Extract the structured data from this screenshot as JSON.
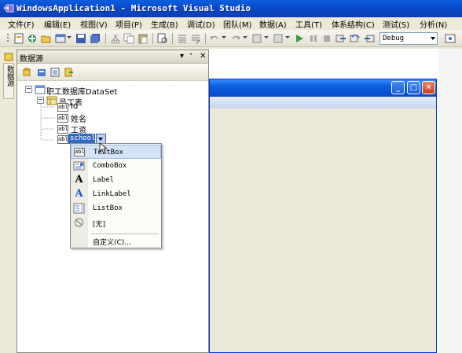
{
  "window": {
    "title": "WindowsApplication1 - Microsoft Visual Studio"
  },
  "menu": [
    {
      "label": "文件(F)"
    },
    {
      "label": "编辑(E)"
    },
    {
      "label": "视图(V)"
    },
    {
      "label": "项目(P)"
    },
    {
      "label": "生成(B)"
    },
    {
      "label": "调试(D)"
    },
    {
      "label": "团队(M)"
    },
    {
      "label": "数据(A)"
    },
    {
      "label": "工具(T)"
    },
    {
      "label": "体系结构(C)"
    },
    {
      "label": "测试(S)"
    },
    {
      "label": "分析(N)"
    }
  ],
  "toolbar": {
    "configuration": "Debug"
  },
  "left_strip": {
    "tab_label": "数据源"
  },
  "data_sources": {
    "title": "数据源",
    "header_buttons": {
      "dropdown": "▾",
      "pin": "ᐩ",
      "close": "✕"
    },
    "tree": {
      "dataset": "职工数据库DataSet",
      "table": "员工表",
      "fields": [
        {
          "label": "Id",
          "icon_text": "abl"
        },
        {
          "label": "姓名",
          "icon_text": "abl"
        },
        {
          "label": "工资",
          "icon_text": "abl"
        }
      ],
      "selected_field": {
        "label": "school",
        "icon_text": "abl"
      },
      "expander_minus": "−"
    }
  },
  "control_menu": {
    "items": [
      {
        "label": "TextBox",
        "icon": "textbox-icon",
        "icon_text": "abl",
        "selected": true
      },
      {
        "label": "ComboBox",
        "icon": "combobox-icon"
      },
      {
        "label": "Label",
        "icon": "label-icon",
        "icon_text": "A"
      },
      {
        "label": "LinkLabel",
        "icon": "linklabel-icon",
        "icon_text": "A"
      },
      {
        "label": "ListBox",
        "icon": "listbox-icon"
      },
      {
        "label": "[无]",
        "icon": "none-icon"
      }
    ],
    "customize": "自定义(C)..."
  },
  "form": {
    "buttons": {
      "minimize": "_",
      "maximize": "□",
      "close": "✕"
    }
  },
  "colors": {
    "titlebar": "#0a4ac9",
    "selection": "#316ac5",
    "menu_highlight": "#d4e3f7"
  }
}
